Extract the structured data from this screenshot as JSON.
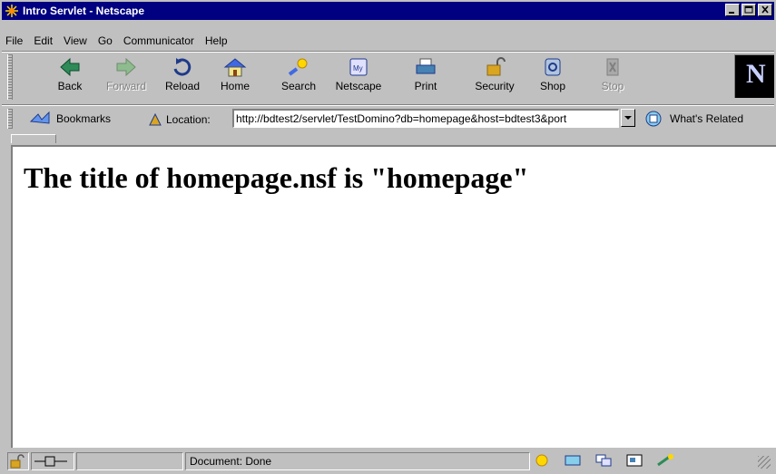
{
  "window": {
    "title": "Intro Servlet - Netscape"
  },
  "menu": [
    "File",
    "Edit",
    "View",
    "Go",
    "Communicator",
    "Help"
  ],
  "toolbar": {
    "buttons": [
      {
        "label": "Back",
        "icon": "back-arrow-icon",
        "enabled": true
      },
      {
        "label": "Forward",
        "icon": "forward-arrow-icon",
        "enabled": false
      },
      {
        "label": "Reload",
        "icon": "reload-icon",
        "enabled": true
      },
      {
        "label": "Home",
        "icon": "home-icon",
        "enabled": true
      },
      {
        "label": "Search",
        "icon": "search-icon",
        "enabled": true
      },
      {
        "label": "Netscape",
        "icon": "my-netscape-icon",
        "enabled": true
      },
      {
        "label": "Print",
        "icon": "print-icon",
        "enabled": true
      },
      {
        "label": "Security",
        "icon": "security-lock-icon",
        "enabled": true
      },
      {
        "label": "Shop",
        "icon": "shop-icon",
        "enabled": true
      },
      {
        "label": "Stop",
        "icon": "stop-icon",
        "enabled": false
      }
    ],
    "logo_letter": "N"
  },
  "location_bar": {
    "bookmarks_label": "Bookmarks",
    "location_label": "Location:",
    "url": "http://bdtest2/servlet/TestDomino?db=homepage&host=bdtest3&port",
    "whats_related": "What's Related"
  },
  "content": {
    "heading": "The title of homepage.nsf is \"homepage\""
  },
  "status": {
    "text": "Document: Done"
  },
  "colors": {
    "title_bar": "#000080",
    "chrome": "#c0c0c0",
    "page_background": "#ffffff"
  }
}
